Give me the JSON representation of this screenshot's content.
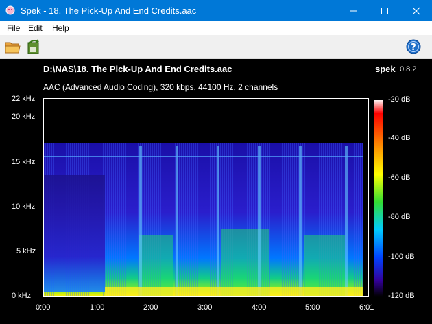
{
  "window": {
    "title": "Spek - 18. The Pick-Up And End Credits.aac",
    "accent": "#0078d7"
  },
  "menu": [
    "File",
    "Edit",
    "Help"
  ],
  "toolbar": {
    "icons": [
      "folder-open-icon",
      "save-icon",
      "help-icon"
    ]
  },
  "header": {
    "file_path": "D:\\NAS\\18. The Pick-Up And End Credits.aac",
    "app_name": "spek",
    "version": "0.8.2",
    "codec_info": "AAC (Advanced Audio Coding), 320 kbps, 44100 Hz, 2 channels"
  },
  "chart_data": {
    "type": "heatmap",
    "x_ticks": [
      "0:00",
      "1:00",
      "2:00",
      "3:00",
      "4:00",
      "5:00",
      "6:01"
    ],
    "y_ticks": [
      "0 kHz",
      "5 kHz",
      "10 kHz",
      "15 kHz",
      "20 kHz",
      "22 kHz"
    ],
    "colorbar_ticks": [
      "-20 dB",
      "-40 dB",
      "-60 dB",
      "-80 dB",
      "-100 dB",
      "-120 dB"
    ],
    "x_range_seconds": [
      0,
      361
    ],
    "y_range_khz": [
      0,
      22
    ],
    "colorbar_range_db": [
      -120,
      -20
    ],
    "cutoff_khz": 17
  }
}
